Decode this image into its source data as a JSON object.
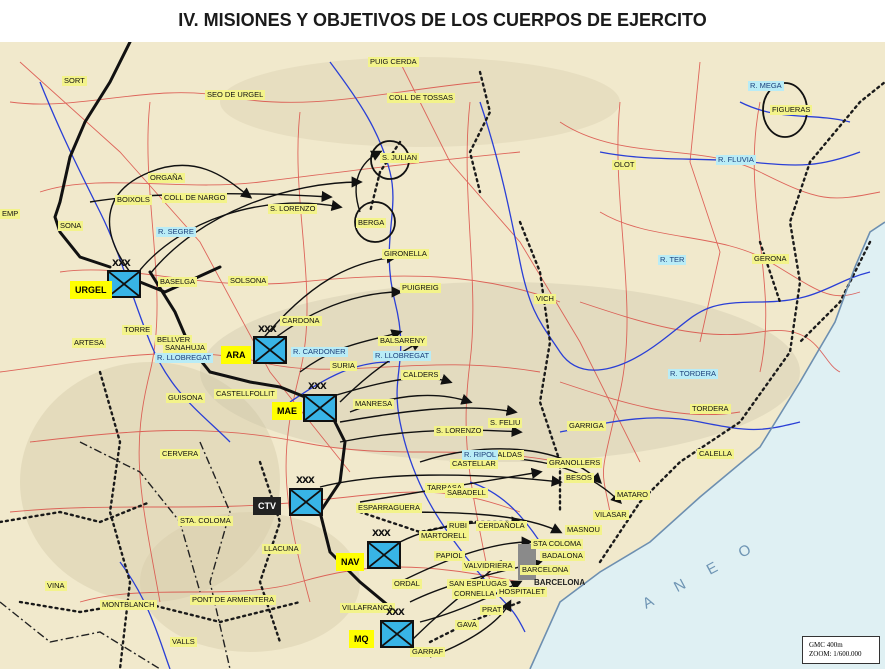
{
  "title": "IV. MISIONES Y OBJETIVOS DE LOS CUERPOS DE EJERCITO",
  "colors": {
    "map_paper": "#f1e9cc",
    "road_red": "#d9443e",
    "river_blue": "#2a3fd6",
    "unit_fill": "#38b4e6",
    "tag_yellow": "#ffff00",
    "label_yellow": "#f3f38a",
    "river_label": "#b9ecf6",
    "sea": "#dff0f3"
  },
  "units": [
    {
      "name": "URGEL",
      "echelon": "XXX",
      "tag_style": "yellow"
    },
    {
      "name": "ARA",
      "echelon": "XXX",
      "tag_style": "yellow"
    },
    {
      "name": "MAE",
      "echelon": "XXX",
      "tag_style": "yellow"
    },
    {
      "name": "CTV",
      "echelon": "XXX",
      "tag_style": "dark"
    },
    {
      "name": "NAV",
      "echelon": "XXX",
      "tag_style": "yellow"
    },
    {
      "name": "MQ",
      "echelon": "XXX",
      "tag_style": "yellow"
    }
  ],
  "places": {
    "sort": "SORT",
    "puig_cerda": "PUIG CERDA",
    "seo_urgel": "SEO DE URGEL",
    "coll_tossas": "COLL DE TOSSAS",
    "figueras": "FIGUERAS",
    "s_julian": "S. JULIAN",
    "olot": "OLOT",
    "organa": "ORGAÑA",
    "boixols": "BOIXOLS",
    "coll_nargo": "COLL DE NARGO",
    "s_lorenzo_n": "S. LORENZO",
    "berga": "BERGA",
    "emp": "EMP",
    "sona": "SONA",
    "gironella": "GIRONELLA",
    "gerona": "GERONA",
    "baselga": "BASELGA",
    "solsona": "SOLSONA",
    "puig_reig": "PUIGREIG",
    "vich": "VICH",
    "cardona": "CARDONA",
    "balsareny": "BALSARENY",
    "calders": "CALDERS",
    "suria": "SURIA",
    "manresa": "MANRESA",
    "tordera": "TORDERA",
    "s_lorenzo_s": "S. LORENZO",
    "s_feliu": "S. FELIU",
    "garriga": "GARRIGA",
    "calella": "CALELLA",
    "guisona": "GUISONA",
    "castellfollit": "CASTELLFOLLIT",
    "caldas": "CALDAS",
    "castellar": "CASTELLAR",
    "granollers": "GRANOLLERS",
    "tarrasa": "TARRASA",
    "sabadell": "SABADELL",
    "besos": "BESOS",
    "mataro": "MATARO",
    "esparraguera": "ESPARRAGUERA",
    "vilasar": "VILASAR",
    "masnou": "MASNOU",
    "martorell": "MARTORELL",
    "cerdanola": "CERDAÑOLA",
    "sta_coloma_n": "STA COLOMA",
    "badalona": "BADALONA",
    "barcelona": "BARCELONA",
    "valvidriera": "VALVIDRIERA",
    "esplugas": "SAN ESPLUGAS",
    "cornella": "CORNELLA",
    "hospitalet": "HOSPITALET",
    "ordal": "ORDAL",
    "villafranca": "VILLAFRANCA",
    "prat": "PRAT",
    "gava": "GAVA",
    "garraf": "GARRAF",
    "llacuna": "LLACUNA",
    "sta_coloma_w": "STA. COLOMA",
    "montblanc": "MONTBLANCH",
    "pont_armentera": "PONT DE ARMENTERA",
    "vinaixa": "VINA",
    "valls": "VALLS",
    "cervera": "CERVERA",
    "artesa": "ARTESA",
    "bellver": "BELLVER",
    "sanahuja": "SANAHUJA",
    "torre": "TORRE",
    "barcelona_coast": "BARCELONA",
    "sea": "A N E O",
    "rubi": "RUBI",
    "papiol": "PAPIOL"
  },
  "rivers": {
    "mega": "R. MEGA",
    "fluvia": "R. FLUVIA",
    "segre": "R. SEGRE",
    "ter": "R. TER",
    "cardoner": "R. CARDONER",
    "llobregat_e": "R. LLOBREGAT",
    "llobregat_w": "R. LLOBREGAT",
    "tordera": "R. TORDERA",
    "ripoll": "R. RIPOL"
  },
  "scale_box": {
    "line1": "GMC 400m",
    "line2": "ZOOM: 1/600.000"
  }
}
